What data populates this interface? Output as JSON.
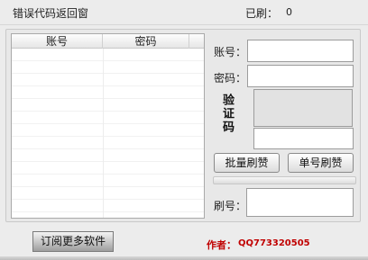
{
  "status": {
    "error_window_title": "错误代码返回窗",
    "refreshed_label": "已刷：",
    "refreshed_count": "0"
  },
  "account_list": {
    "columns": [
      "账号",
      "密码"
    ],
    "rows": []
  },
  "form": {
    "account_label": "账号：",
    "account_value": "",
    "password_label": "密码：",
    "password_value": "",
    "captcha_label": "验证码",
    "captcha_value": "",
    "batch_button": "批量刷赞",
    "single_button": "单号刷赞",
    "refresh_id_label": "刷号：",
    "refresh_id_value": ""
  },
  "footer": {
    "subscribe_button": "订阅更多软件",
    "author_label": "作者：",
    "author_value": "QQ773320505"
  }
}
